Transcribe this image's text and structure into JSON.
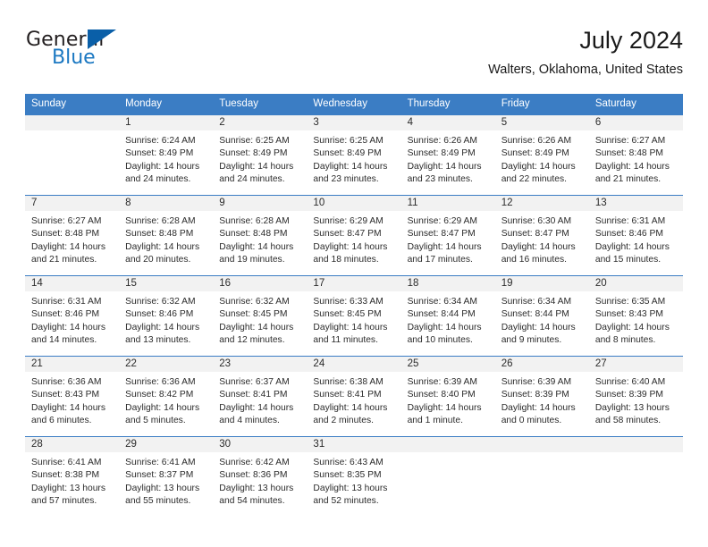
{
  "brand": {
    "name_part1": "General",
    "name_part2": "Blue"
  },
  "header": {
    "title": "July 2024",
    "subtitle": "Walters, Oklahoma, United States"
  },
  "colors": {
    "header_blue": "#3b7dc4",
    "logo_blue": "#1b78c2",
    "band_gray": "#f2f2f2"
  },
  "weekdays": [
    "Sunday",
    "Monday",
    "Tuesday",
    "Wednesday",
    "Thursday",
    "Friday",
    "Saturday"
  ],
  "weeks": [
    [
      {
        "day": "",
        "sunrise": "",
        "sunset": "",
        "daylight_line1": "",
        "daylight_line2": ""
      },
      {
        "day": "1",
        "sunrise": "Sunrise: 6:24 AM",
        "sunset": "Sunset: 8:49 PM",
        "daylight_line1": "Daylight: 14 hours",
        "daylight_line2": "and 24 minutes."
      },
      {
        "day": "2",
        "sunrise": "Sunrise: 6:25 AM",
        "sunset": "Sunset: 8:49 PM",
        "daylight_line1": "Daylight: 14 hours",
        "daylight_line2": "and 24 minutes."
      },
      {
        "day": "3",
        "sunrise": "Sunrise: 6:25 AM",
        "sunset": "Sunset: 8:49 PM",
        "daylight_line1": "Daylight: 14 hours",
        "daylight_line2": "and 23 minutes."
      },
      {
        "day": "4",
        "sunrise": "Sunrise: 6:26 AM",
        "sunset": "Sunset: 8:49 PM",
        "daylight_line1": "Daylight: 14 hours",
        "daylight_line2": "and 23 minutes."
      },
      {
        "day": "5",
        "sunrise": "Sunrise: 6:26 AM",
        "sunset": "Sunset: 8:49 PM",
        "daylight_line1": "Daylight: 14 hours",
        "daylight_line2": "and 22 minutes."
      },
      {
        "day": "6",
        "sunrise": "Sunrise: 6:27 AM",
        "sunset": "Sunset: 8:48 PM",
        "daylight_line1": "Daylight: 14 hours",
        "daylight_line2": "and 21 minutes."
      }
    ],
    [
      {
        "day": "7",
        "sunrise": "Sunrise: 6:27 AM",
        "sunset": "Sunset: 8:48 PM",
        "daylight_line1": "Daylight: 14 hours",
        "daylight_line2": "and 21 minutes."
      },
      {
        "day": "8",
        "sunrise": "Sunrise: 6:28 AM",
        "sunset": "Sunset: 8:48 PM",
        "daylight_line1": "Daylight: 14 hours",
        "daylight_line2": "and 20 minutes."
      },
      {
        "day": "9",
        "sunrise": "Sunrise: 6:28 AM",
        "sunset": "Sunset: 8:48 PM",
        "daylight_line1": "Daylight: 14 hours",
        "daylight_line2": "and 19 minutes."
      },
      {
        "day": "10",
        "sunrise": "Sunrise: 6:29 AM",
        "sunset": "Sunset: 8:47 PM",
        "daylight_line1": "Daylight: 14 hours",
        "daylight_line2": "and 18 minutes."
      },
      {
        "day": "11",
        "sunrise": "Sunrise: 6:29 AM",
        "sunset": "Sunset: 8:47 PM",
        "daylight_line1": "Daylight: 14 hours",
        "daylight_line2": "and 17 minutes."
      },
      {
        "day": "12",
        "sunrise": "Sunrise: 6:30 AM",
        "sunset": "Sunset: 8:47 PM",
        "daylight_line1": "Daylight: 14 hours",
        "daylight_line2": "and 16 minutes."
      },
      {
        "day": "13",
        "sunrise": "Sunrise: 6:31 AM",
        "sunset": "Sunset: 8:46 PM",
        "daylight_line1": "Daylight: 14 hours",
        "daylight_line2": "and 15 minutes."
      }
    ],
    [
      {
        "day": "14",
        "sunrise": "Sunrise: 6:31 AM",
        "sunset": "Sunset: 8:46 PM",
        "daylight_line1": "Daylight: 14 hours",
        "daylight_line2": "and 14 minutes."
      },
      {
        "day": "15",
        "sunrise": "Sunrise: 6:32 AM",
        "sunset": "Sunset: 8:46 PM",
        "daylight_line1": "Daylight: 14 hours",
        "daylight_line2": "and 13 minutes."
      },
      {
        "day": "16",
        "sunrise": "Sunrise: 6:32 AM",
        "sunset": "Sunset: 8:45 PM",
        "daylight_line1": "Daylight: 14 hours",
        "daylight_line2": "and 12 minutes."
      },
      {
        "day": "17",
        "sunrise": "Sunrise: 6:33 AM",
        "sunset": "Sunset: 8:45 PM",
        "daylight_line1": "Daylight: 14 hours",
        "daylight_line2": "and 11 minutes."
      },
      {
        "day": "18",
        "sunrise": "Sunrise: 6:34 AM",
        "sunset": "Sunset: 8:44 PM",
        "daylight_line1": "Daylight: 14 hours",
        "daylight_line2": "and 10 minutes."
      },
      {
        "day": "19",
        "sunrise": "Sunrise: 6:34 AM",
        "sunset": "Sunset: 8:44 PM",
        "daylight_line1": "Daylight: 14 hours",
        "daylight_line2": "and 9 minutes."
      },
      {
        "day": "20",
        "sunrise": "Sunrise: 6:35 AM",
        "sunset": "Sunset: 8:43 PM",
        "daylight_line1": "Daylight: 14 hours",
        "daylight_line2": "and 8 minutes."
      }
    ],
    [
      {
        "day": "21",
        "sunrise": "Sunrise: 6:36 AM",
        "sunset": "Sunset: 8:43 PM",
        "daylight_line1": "Daylight: 14 hours",
        "daylight_line2": "and 6 minutes."
      },
      {
        "day": "22",
        "sunrise": "Sunrise: 6:36 AM",
        "sunset": "Sunset: 8:42 PM",
        "daylight_line1": "Daylight: 14 hours",
        "daylight_line2": "and 5 minutes."
      },
      {
        "day": "23",
        "sunrise": "Sunrise: 6:37 AM",
        "sunset": "Sunset: 8:41 PM",
        "daylight_line1": "Daylight: 14 hours",
        "daylight_line2": "and 4 minutes."
      },
      {
        "day": "24",
        "sunrise": "Sunrise: 6:38 AM",
        "sunset": "Sunset: 8:41 PM",
        "daylight_line1": "Daylight: 14 hours",
        "daylight_line2": "and 2 minutes."
      },
      {
        "day": "25",
        "sunrise": "Sunrise: 6:39 AM",
        "sunset": "Sunset: 8:40 PM",
        "daylight_line1": "Daylight: 14 hours",
        "daylight_line2": "and 1 minute."
      },
      {
        "day": "26",
        "sunrise": "Sunrise: 6:39 AM",
        "sunset": "Sunset: 8:39 PM",
        "daylight_line1": "Daylight: 14 hours",
        "daylight_line2": "and 0 minutes."
      },
      {
        "day": "27",
        "sunrise": "Sunrise: 6:40 AM",
        "sunset": "Sunset: 8:39 PM",
        "daylight_line1": "Daylight: 13 hours",
        "daylight_line2": "and 58 minutes."
      }
    ],
    [
      {
        "day": "28",
        "sunrise": "Sunrise: 6:41 AM",
        "sunset": "Sunset: 8:38 PM",
        "daylight_line1": "Daylight: 13 hours",
        "daylight_line2": "and 57 minutes."
      },
      {
        "day": "29",
        "sunrise": "Sunrise: 6:41 AM",
        "sunset": "Sunset: 8:37 PM",
        "daylight_line1": "Daylight: 13 hours",
        "daylight_line2": "and 55 minutes."
      },
      {
        "day": "30",
        "sunrise": "Sunrise: 6:42 AM",
        "sunset": "Sunset: 8:36 PM",
        "daylight_line1": "Daylight: 13 hours",
        "daylight_line2": "and 54 minutes."
      },
      {
        "day": "31",
        "sunrise": "Sunrise: 6:43 AM",
        "sunset": "Sunset: 8:35 PM",
        "daylight_line1": "Daylight: 13 hours",
        "daylight_line2": "and 52 minutes."
      },
      {
        "day": "",
        "sunrise": "",
        "sunset": "",
        "daylight_line1": "",
        "daylight_line2": ""
      },
      {
        "day": "",
        "sunrise": "",
        "sunset": "",
        "daylight_line1": "",
        "daylight_line2": ""
      },
      {
        "day": "",
        "sunrise": "",
        "sunset": "",
        "daylight_line1": "",
        "daylight_line2": ""
      }
    ]
  ]
}
